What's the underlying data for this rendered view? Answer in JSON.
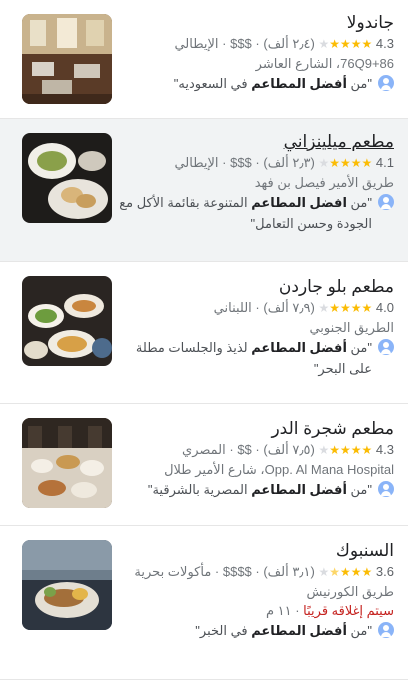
{
  "restaurants": [
    {
      "name": "جاندولا",
      "rating": "4.3",
      "reviews": "(٢٫٤ ألف)",
      "price": "$$$",
      "cuisine": "الإيطالي",
      "address": "76Q9+86، الشارع العاشر",
      "review_prefix": "\"من ",
      "review_bold": "أفضل المطاعم",
      "review_rest": " في السعوديه\""
    },
    {
      "name": "مطعم ميلينزاني",
      "rating": "4.1",
      "reviews": "(٢٫٣ ألف)",
      "price": "$$$",
      "cuisine": "الإيطالي",
      "address": "طريق الأمير فيصل بن فهد",
      "review_prefix": "\"من ",
      "review_bold": "افضل المطاعم",
      "review_rest": " المتنوعة بقائمة الأكل مع الجودة وحسن التعامل\""
    },
    {
      "name": "مطعم بلو جاردن",
      "rating": "4.0",
      "reviews": "(٧٫٩ ألف)",
      "price": "",
      "cuisine": "اللبناني",
      "address": "الطريق الجنوبي",
      "review_prefix": "\"من ",
      "review_bold": "أفضل المطاعم",
      "review_rest": " لذيذ والجلسات مطلة على البحر\""
    },
    {
      "name": "مطعم شجرة الدر",
      "rating": "4.3",
      "reviews": "(٧٫٥ ألف)",
      "price": "$$",
      "cuisine": "المصري",
      "address": "Opp. Al Mana Hospital، شارع الأمير طلال",
      "review_prefix": "\"من ",
      "review_bold": "أفضل المطاعم",
      "review_rest": " المصرية بالشرقية\""
    },
    {
      "name": "السنبوك",
      "rating": "3.6",
      "reviews": "(٣٫١ ألف)",
      "price": "$$$$",
      "cuisine": "مأكولات بحرية",
      "address": "طريق الكورنيش",
      "status": "سيتم إغلاقه قريبًا",
      "status_time": "١١ م",
      "review_prefix": "\"من ",
      "review_bold": "أفضل المطاعم",
      "review_rest": " في الخبر\""
    }
  ],
  "sep": " · ",
  "colors": {
    "star": "#fbbc04",
    "closing": "#c5221f",
    "selected_bg": "#f1f3f4"
  }
}
